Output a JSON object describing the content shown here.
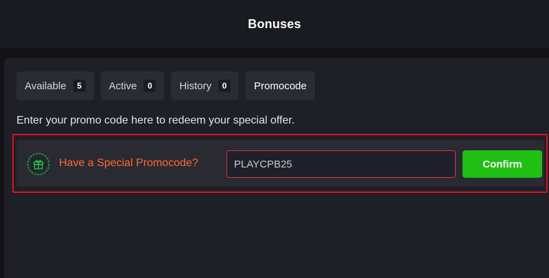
{
  "header": {
    "title": "Bonuses"
  },
  "tabs": [
    {
      "label": "Available",
      "count": "5"
    },
    {
      "label": "Active",
      "count": "0"
    },
    {
      "label": "History",
      "count": "0"
    },
    {
      "label": "Promocode",
      "count": null
    }
  ],
  "promo": {
    "description": "Enter your promo code here to redeem your special offer.",
    "label": "Have a Special Promocode?",
    "code_value": "PLAYCPB25",
    "confirm_label": "Confirm",
    "icon": "gift-icon"
  },
  "colors": {
    "accent_orange": "#ff6a2c",
    "confirm_green": "#1fbf14",
    "highlight_red": "#e0141b",
    "gift_green": "#1fa84a"
  }
}
